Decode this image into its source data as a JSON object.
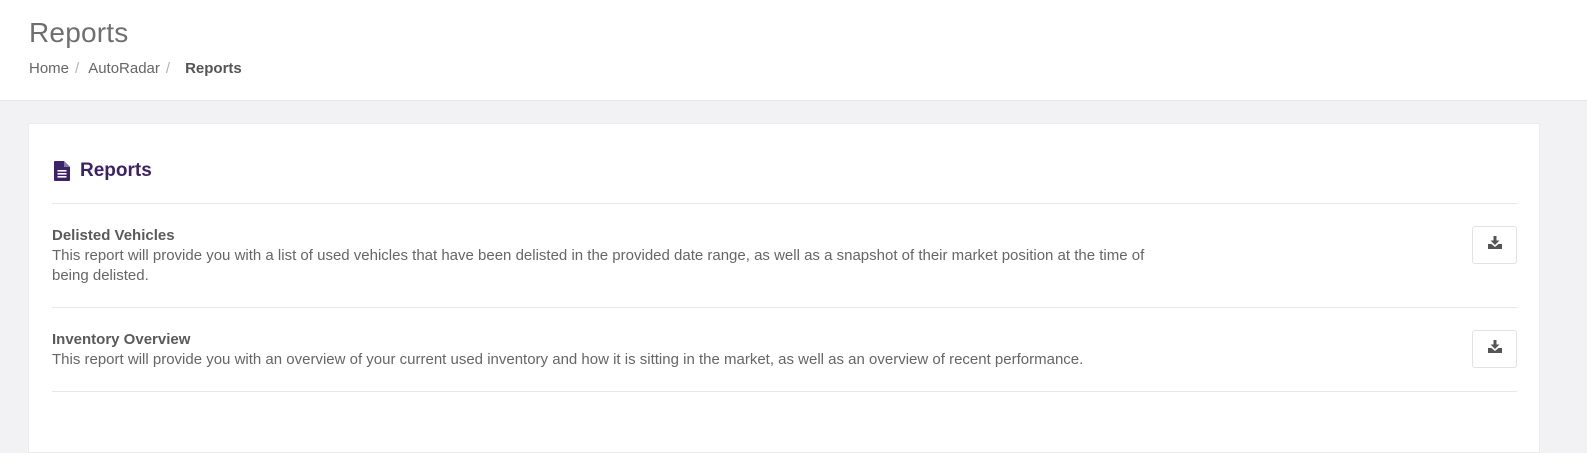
{
  "header": {
    "title": "Reports",
    "breadcrumb": {
      "items": [
        "Home",
        "AutoRadar"
      ],
      "current": "Reports",
      "separator": "/"
    }
  },
  "card": {
    "icon": "file-text-icon",
    "title": "Reports",
    "accent_color": "#3d2366",
    "reports": [
      {
        "name": "Delisted Vehicles",
        "description": "This report will provide you with a list of used vehicles that have been delisted in the provided date range, as well as a snapshot of their market position at the time of being delisted.",
        "action_icon": "download-icon"
      },
      {
        "name": "Inventory Overview",
        "description": "This report will provide you with an overview of your current used inventory and how it is sitting in the market, as well as an overview of recent performance.",
        "action_icon": "download-icon"
      }
    ]
  }
}
